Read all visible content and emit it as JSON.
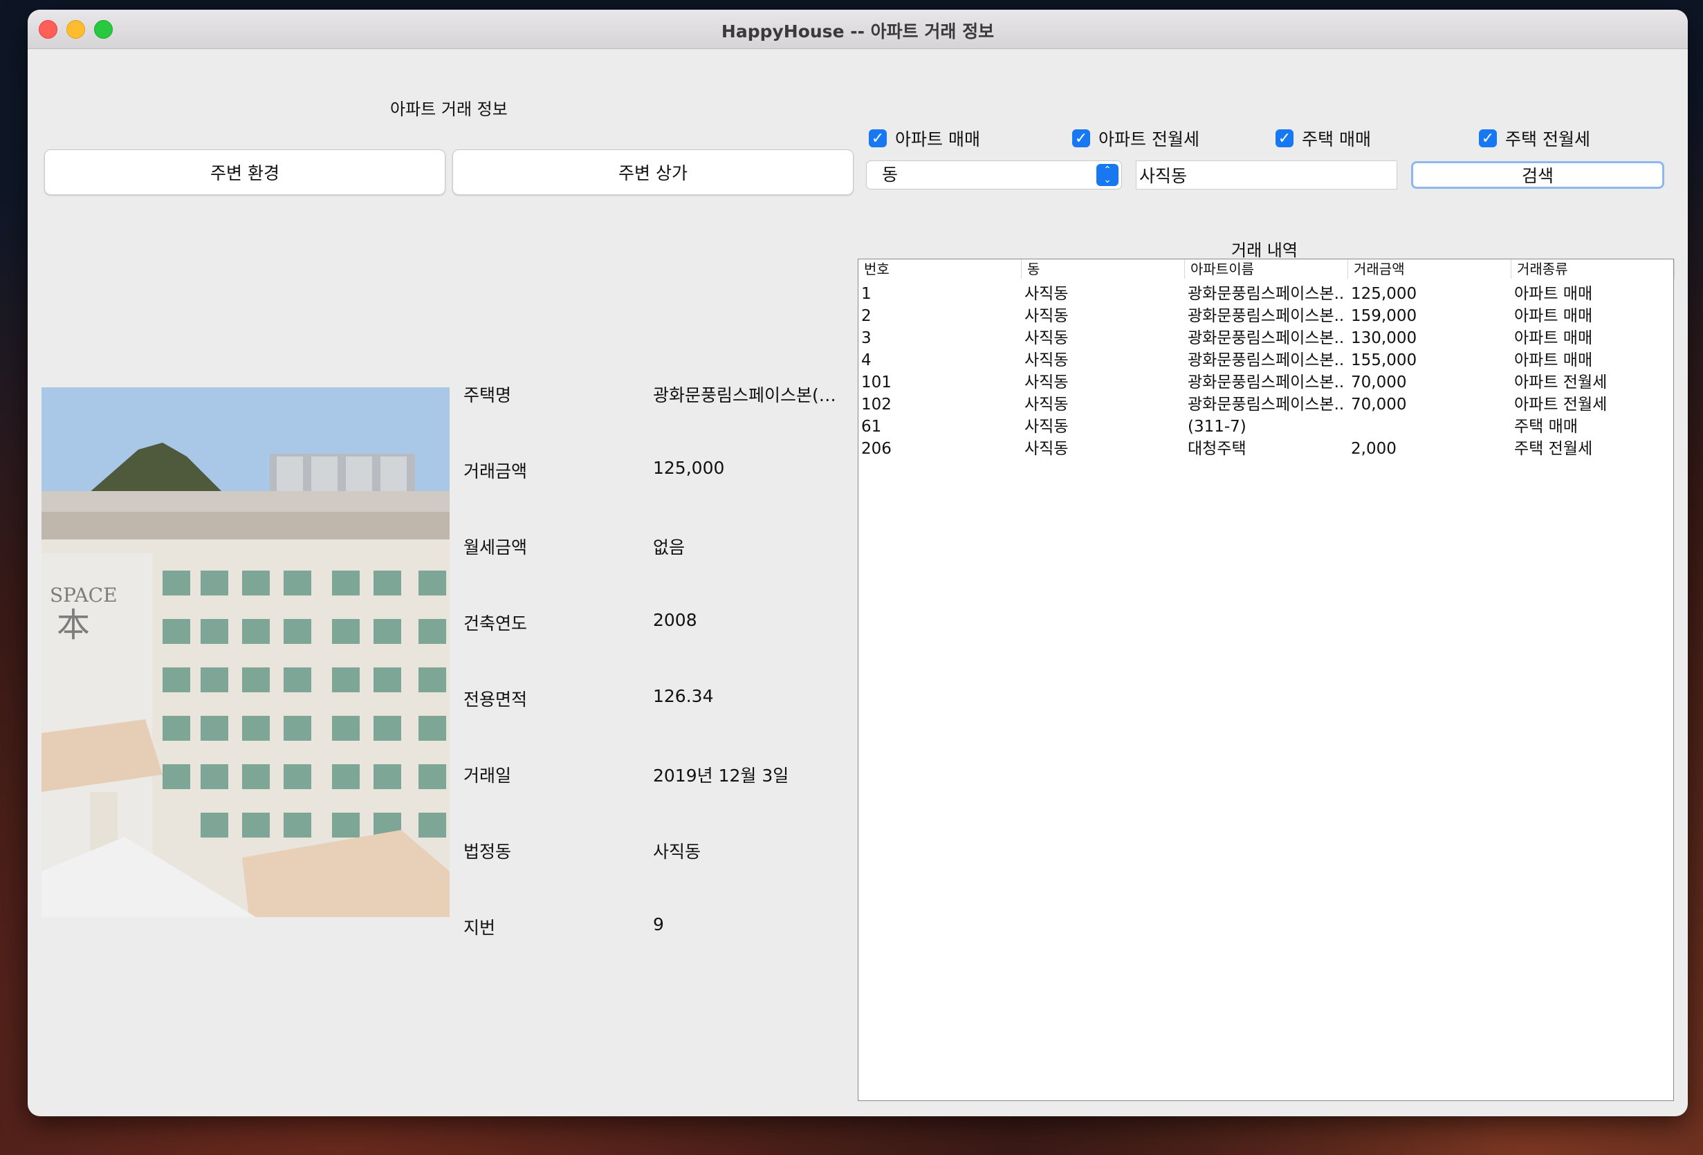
{
  "window": {
    "title": "HappyHouse -- 아파트 거래 정보"
  },
  "left_panel": {
    "section_title": "아파트 거래 정보",
    "buttons": {
      "env": "주변 환경",
      "shops": "주변 상가"
    }
  },
  "filters": {
    "checkboxes": [
      {
        "label": "아파트 매매",
        "checked": true
      },
      {
        "label": "아파트 전월세",
        "checked": true
      },
      {
        "label": "주택 매매",
        "checked": true
      },
      {
        "label": "주택 전월세",
        "checked": true
      }
    ],
    "select_value": "동",
    "search_value": "사직동",
    "search_button": "검색"
  },
  "detail": {
    "rows": [
      {
        "label": "주택명",
        "value": "광화문풍림스페이스본(1..."
      },
      {
        "label": "거래금액",
        "value": " 125,000"
      },
      {
        "label": "월세금액",
        "value": "없음"
      },
      {
        "label": "건축연도",
        "value": "2008"
      },
      {
        "label": "전용면적",
        "value": "126.34"
      },
      {
        "label": "거래일",
        "value": "2019년 12월 3일"
      },
      {
        "label": "법정동",
        "value": "사직동"
      },
      {
        "label": "지번",
        "value": "9"
      }
    ],
    "photo_sign": "SPACE 本"
  },
  "table": {
    "title": "거래 내역",
    "columns": [
      "번호",
      "동",
      "아파트이름",
      "거래금액",
      "거래종류"
    ],
    "rows": [
      [
        "1",
        "사직동",
        "광화문풍림스페이스본...",
        " 125,000",
        "아파트 매매"
      ],
      [
        "2",
        "사직동",
        "광화문풍림스페이스본...",
        " 159,000",
        "아파트 매매"
      ],
      [
        "3",
        "사직동",
        "광화문풍림스페이스본...",
        " 130,000",
        "아파트 매매"
      ],
      [
        "4",
        "사직동",
        "광화문풍림스페이스본...",
        " 155,000",
        "아파트 매매"
      ],
      [
        "101",
        "사직동",
        "광화문풍림스페이스본...",
        "70,000",
        "아파트 전월세"
      ],
      [
        "102",
        "사직동",
        "광화문풍림스페이스본...",
        "70,000",
        "아파트 전월세"
      ],
      [
        "61",
        "사직동",
        "(311-7)",
        "",
        "주택 매매"
      ],
      [
        "206",
        "사직동",
        "대청주택",
        " 2,000",
        "주택 전월세"
      ]
    ]
  },
  "colors": {
    "accent": "#1778f2",
    "window_bg": "#ececec"
  }
}
